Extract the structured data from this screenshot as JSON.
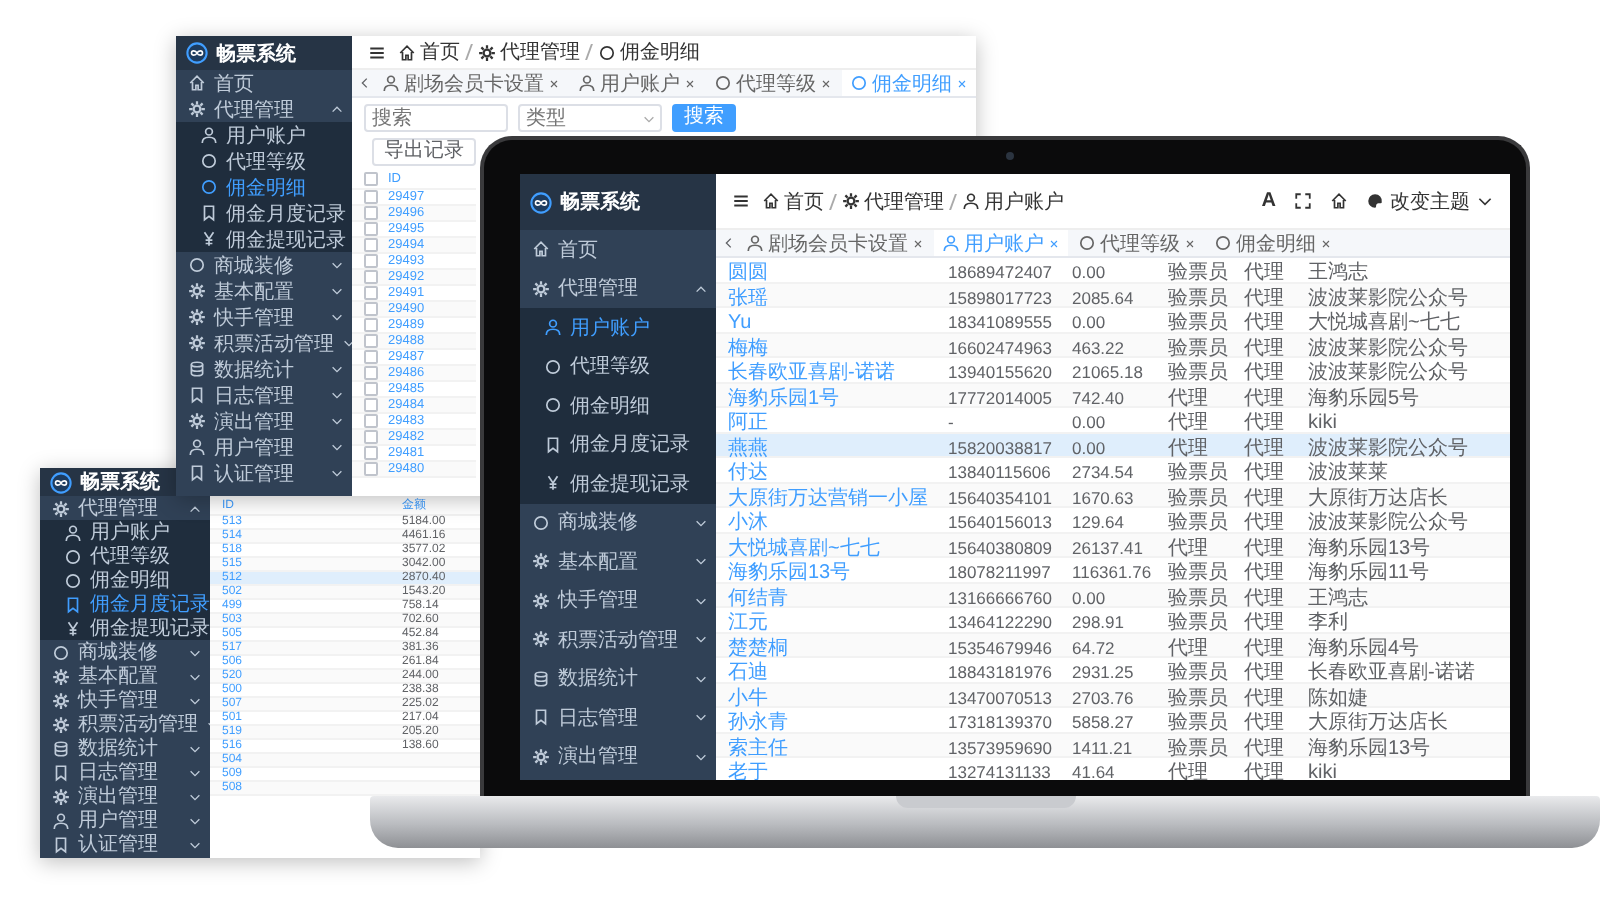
{
  "back_window": {
    "brand": "畅票系统",
    "sidebar": [
      {
        "label": "首页",
        "selected": false
      },
      {
        "label": "代理管理",
        "selected": false,
        "expanded": true,
        "children": [
          {
            "label": "用户账户",
            "selected": false
          },
          {
            "label": "代理等级",
            "selected": false
          },
          {
            "label": "佣金明细",
            "selected": true
          },
          {
            "label": "佣金月度记录",
            "selected": false
          },
          {
            "label": "佣金提现记录",
            "selected": false
          }
        ]
      },
      {
        "label": "商城装修",
        "selected": false,
        "expanded": false
      },
      {
        "label": "基本配置",
        "selected": false,
        "expanded": false
      },
      {
        "label": "快手管理",
        "selected": false,
        "expanded": false
      },
      {
        "label": "积票活动管理",
        "selected": false,
        "expanded": false
      },
      {
        "label": "数据统计",
        "selected": false,
        "expanded": false
      },
      {
        "label": "日志管理",
        "selected": false,
        "expanded": false
      },
      {
        "label": "演出管理",
        "selected": false,
        "expanded": false
      },
      {
        "label": "用户管理",
        "selected": false,
        "expanded": false
      },
      {
        "label": "认证管理",
        "selected": false,
        "expanded": false
      }
    ],
    "breadcrumb": [
      {
        "label": "首页"
      },
      {
        "label": "代理管理"
      },
      {
        "label": "佣金明细"
      }
    ],
    "tabs": [
      {
        "label": "剧场会员卡设置",
        "selected": false
      },
      {
        "label": "用户账户",
        "selected": false
      },
      {
        "label": "代理等级",
        "selected": false
      },
      {
        "label": "佣金明细",
        "selected": true
      }
    ],
    "filters": [
      {
        "kind": "input",
        "placeholder": "搜索"
      },
      {
        "kind": "select",
        "placeholder": "类型"
      },
      {
        "kind": "button",
        "label": "搜索"
      }
    ],
    "toolbar": [
      "导出记录"
    ],
    "table": {
      "header_checked": false,
      "columns": [
        {
          "kind": "link",
          "label": "ID"
        }
      ],
      "rows": [
        {
          "checked": false,
          "cells": [
            "29497"
          ]
        },
        {
          "checked": false,
          "cells": [
            "29496"
          ]
        },
        {
          "checked": false,
          "cells": [
            "29495"
          ]
        },
        {
          "checked": false,
          "cells": [
            "29494"
          ]
        },
        {
          "checked": false,
          "cells": [
            "29493"
          ]
        },
        {
          "checked": false,
          "cells": [
            "29492"
          ]
        },
        {
          "checked": false,
          "cells": [
            "29491"
          ]
        },
        {
          "checked": false,
          "cells": [
            "29490"
          ]
        },
        {
          "checked": false,
          "cells": [
            "29489"
          ]
        },
        {
          "checked": false,
          "cells": [
            "29488"
          ]
        },
        {
          "checked": false,
          "cells": [
            "29487"
          ]
        },
        {
          "checked": false,
          "cells": [
            "29486"
          ]
        },
        {
          "checked": false,
          "cells": [
            "29485"
          ]
        },
        {
          "checked": false,
          "cells": [
            "29484"
          ]
        },
        {
          "checked": false,
          "cells": [
            "29483"
          ]
        },
        {
          "checked": false,
          "cells": [
            "29482"
          ]
        },
        {
          "checked": false,
          "cells": [
            "29481"
          ]
        },
        {
          "checked": false,
          "cells": [
            "29480"
          ]
        }
      ]
    }
  },
  "side_window": {
    "brand": "畅票系统",
    "sidebar": [
      {
        "label": "代理管理",
        "selected": false,
        "expanded": true,
        "children": [
          {
            "label": "用户账户",
            "selected": false
          },
          {
            "label": "代理等级",
            "selected": false
          },
          {
            "label": "佣金明细",
            "selected": false
          },
          {
            "label": "佣金月度记录",
            "selected": true
          },
          {
            "label": "佣金提现记录",
            "selected": false
          }
        ]
      },
      {
        "label": "商城装修",
        "selected": false,
        "expanded": false
      },
      {
        "label": "基本配置",
        "selected": false,
        "expanded": false
      },
      {
        "label": "快手管理",
        "selected": false,
        "expanded": false
      },
      {
        "label": "积票活动管理",
        "selected": false,
        "expanded": false
      },
      {
        "label": "数据统计",
        "selected": false,
        "expanded": false
      },
      {
        "label": "日志管理",
        "selected": false,
        "expanded": false
      },
      {
        "label": "演出管理",
        "selected": false,
        "expanded": false
      },
      {
        "label": "用户管理",
        "selected": false,
        "expanded": false
      },
      {
        "label": "认证管理",
        "selected": false,
        "expanded": false
      }
    ],
    "table": {
      "columns": [
        {
          "kind": "link",
          "label": "ID"
        },
        {
          "kind": "number",
          "label": "金额"
        }
      ],
      "rows": [
        {
          "selected": false,
          "cells": [
            "513",
            "5184.00"
          ]
        },
        {
          "selected": false,
          "cells": [
            "514",
            "4461.16"
          ]
        },
        {
          "selected": false,
          "cells": [
            "518",
            "3577.02"
          ]
        },
        {
          "selected": false,
          "cells": [
            "515",
            "3042.00"
          ]
        },
        {
          "selected": true,
          "cells": [
            "512",
            "2870.40"
          ]
        },
        {
          "selected": false,
          "cells": [
            "502",
            "1543.20"
          ]
        },
        {
          "selected": false,
          "cells": [
            "499",
            "758.14"
          ]
        },
        {
          "selected": false,
          "cells": [
            "503",
            "702.60"
          ]
        },
        {
          "selected": false,
          "cells": [
            "505",
            "452.84"
          ]
        },
        {
          "selected": false,
          "cells": [
            "517",
            "381.36"
          ]
        },
        {
          "selected": false,
          "cells": [
            "506",
            "261.84"
          ]
        },
        {
          "selected": false,
          "cells": [
            "520",
            "244.00"
          ]
        },
        {
          "selected": false,
          "cells": [
            "500",
            "238.38"
          ]
        },
        {
          "selected": false,
          "cells": [
            "507",
            "225.02"
          ]
        },
        {
          "selected": false,
          "cells": [
            "501",
            "217.04"
          ]
        },
        {
          "selected": false,
          "cells": [
            "519",
            "205.20"
          ]
        },
        {
          "selected": false,
          "cells": [
            "516",
            "138.60"
          ]
        },
        {
          "selected": false,
          "cells": [
            "504"
          ]
        },
        {
          "selected": false,
          "cells": [
            "509"
          ]
        },
        {
          "selected": false,
          "cells": [
            "508"
          ]
        }
      ]
    }
  },
  "laptop_screen": {
    "brand": "畅票系统",
    "sidebar": [
      {
        "label": "首页",
        "selected": false
      },
      {
        "label": "代理管理",
        "selected": false,
        "expanded": true,
        "children": [
          {
            "label": "用户账户",
            "selected": true
          },
          {
            "label": "代理等级",
            "selected": false
          },
          {
            "label": "佣金明细",
            "selected": false
          },
          {
            "label": "佣金月度记录",
            "selected": false
          },
          {
            "label": "佣金提现记录",
            "selected": false
          }
        ]
      },
      {
        "label": "商城装修",
        "selected": false,
        "expanded": false
      },
      {
        "label": "基本配置",
        "selected": false,
        "expanded": false
      },
      {
        "label": "快手管理",
        "selected": false,
        "expanded": false
      },
      {
        "label": "积票活动管理",
        "selected": false,
        "expanded": false
      },
      {
        "label": "数据统计",
        "selected": false,
        "expanded": false
      },
      {
        "label": "日志管理",
        "selected": false,
        "expanded": false
      },
      {
        "label": "演出管理",
        "selected": false,
        "expanded": false
      }
    ],
    "breadcrumb": [
      {
        "label": "首页"
      },
      {
        "label": "代理管理"
      },
      {
        "label": "用户账户"
      }
    ],
    "tools": [
      {
        "kind": "font",
        "label": "A"
      },
      {
        "kind": "fullscreen"
      },
      {
        "kind": "home"
      },
      {
        "kind": "theme",
        "label": "改变主题"
      }
    ],
    "tabs": [
      {
        "label": "剧场会员卡设置",
        "selected": false
      },
      {
        "label": "用户账户",
        "selected": true
      },
      {
        "label": "代理等级",
        "selected": false
      },
      {
        "label": "佣金明细",
        "selected": false
      }
    ],
    "table": {
      "columns": [
        {
          "kind": "link"
        },
        {
          "kind": "number"
        },
        {
          "kind": "number"
        },
        {
          "kind": "text"
        },
        {
          "kind": "text"
        },
        {
          "kind": "text"
        }
      ],
      "rows": [
        {
          "selected": false,
          "cells": [
            "圆圆",
            "18689472407",
            "0.00",
            "验票员",
            "代理",
            "王鸿志"
          ]
        },
        {
          "selected": false,
          "cells": [
            "张瑶",
            "15898017723",
            "2085.64",
            "验票员",
            "代理",
            "波波莱影院公众号"
          ]
        },
        {
          "selected": false,
          "cells": [
            "Yu",
            "18341089555",
            "0.00",
            "验票员",
            "代理",
            "大悦城喜剧~七七"
          ]
        },
        {
          "selected": false,
          "cells": [
            "梅梅",
            "16602474963",
            "463.22",
            "验票员",
            "代理",
            "波波莱影院公众号"
          ]
        },
        {
          "selected": false,
          "cells": [
            "长春欧亚喜剧-诺诺",
            "13940155620",
            "21065.18",
            "验票员",
            "代理",
            "波波莱影院公众号"
          ]
        },
        {
          "selected": false,
          "cells": [
            "海豹乐园1号",
            "17772014005",
            "742.40",
            "代理",
            "代理",
            "海豹乐园5号"
          ]
        },
        {
          "selected": false,
          "cells": [
            "阿正",
            "-",
            "0.00",
            "代理",
            "代理",
            "kiki"
          ]
        },
        {
          "selected": true,
          "cells": [
            "燕燕",
            "15820038817",
            "0.00",
            "代理",
            "代理",
            "波波莱影院公众号"
          ]
        },
        {
          "selected": false,
          "cells": [
            "付达",
            "13840115606",
            "2734.54",
            "验票员",
            "代理",
            "波波莱莱"
          ]
        },
        {
          "selected": false,
          "cells": [
            "大原街万达营销一小屋",
            "15640354101",
            "1670.63",
            "验票员",
            "代理",
            "大原街万达店长"
          ]
        },
        {
          "selected": false,
          "cells": [
            "小沐",
            "15640156013",
            "129.64",
            "验票员",
            "代理",
            "波波莱影院公众号"
          ]
        },
        {
          "selected": false,
          "cells": [
            "大悦城喜剧~七七",
            "15640380809",
            "26137.41",
            "代理",
            "代理",
            "海豹乐园13号"
          ]
        },
        {
          "selected": false,
          "cells": [
            "海豹乐园13号",
            "18078211997",
            "116361.76",
            "验票员",
            "代理",
            "海豹乐园11号"
          ]
        },
        {
          "selected": false,
          "cells": [
            "何结青",
            "13166666760",
            "0.00",
            "验票员",
            "代理",
            "王鸿志"
          ]
        },
        {
          "selected": false,
          "cells": [
            "江元",
            "13464122290",
            "298.91",
            "验票员",
            "代理",
            "李利"
          ]
        },
        {
          "selected": false,
          "cells": [
            "楚楚桐",
            "15354679946",
            "64.72",
            "代理",
            "代理",
            "海豹乐园4号"
          ]
        },
        {
          "selected": false,
          "cells": [
            "石迪",
            "18843181976",
            "2931.25",
            "验票员",
            "代理",
            "长春欧亚喜剧-诺诺"
          ]
        },
        {
          "selected": false,
          "cells": [
            "小牛",
            "13470070513",
            "2703.76",
            "验票员",
            "代理",
            "陈如婕"
          ]
        },
        {
          "selected": false,
          "cells": [
            "孙永青",
            "17318139370",
            "5858.27",
            "验票员",
            "代理",
            "大原街万达店长"
          ]
        },
        {
          "selected": false,
          "cells": [
            "索主任",
            "13573959690",
            "1411.21",
            "验票员",
            "代理",
            "海豹乐园13号"
          ]
        },
        {
          "selected": false,
          "cells": [
            "老于",
            "13274131133",
            "41.64",
            "代理",
            "代理",
            "kiki"
          ]
        }
      ]
    }
  }
}
